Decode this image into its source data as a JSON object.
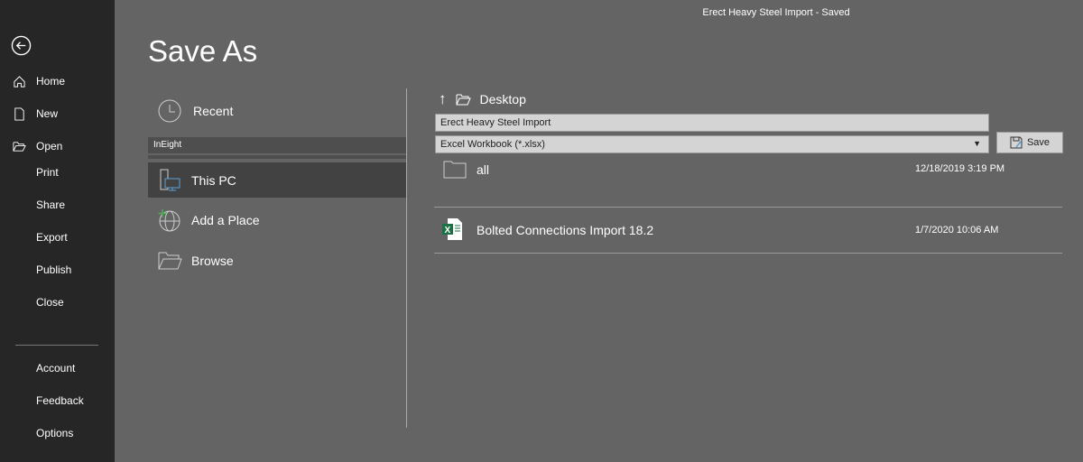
{
  "window": {
    "title": "Erect Heavy Steel Import  -  Saved"
  },
  "sidebar": {
    "items": [
      {
        "label": "Home",
        "icon": "home-icon"
      },
      {
        "label": "New",
        "icon": "new-file-icon"
      },
      {
        "label": "Open",
        "icon": "open-folder-icon"
      },
      {
        "label": "Print"
      },
      {
        "label": "Share"
      },
      {
        "label": "Export"
      },
      {
        "label": "Publish"
      },
      {
        "label": "Close"
      },
      {
        "label": "Account"
      },
      {
        "label": "Feedback"
      },
      {
        "label": "Options"
      }
    ]
  },
  "page": {
    "title": "Save As"
  },
  "locations": {
    "recent": "Recent",
    "group": "InEight",
    "this_pc": "This PC",
    "add_place": "Add a Place",
    "browse": "Browse"
  },
  "browser": {
    "folder": "Desktop",
    "filename": "Erect Heavy Steel Import",
    "filetype": "Excel Workbook (*.xlsx)",
    "save_label": "Save",
    "files": [
      {
        "name": "all",
        "date": "12/18/2019 3:19 PM",
        "type": "folder"
      },
      {
        "name": "Bolted Connections Import 18.2",
        "date": "1/7/2020 10:06 AM",
        "type": "excel"
      }
    ]
  },
  "colors": {
    "sidebar": "#262626",
    "background": "#646464",
    "excel": "#1e7145",
    "accent": "#5aa0d8"
  }
}
